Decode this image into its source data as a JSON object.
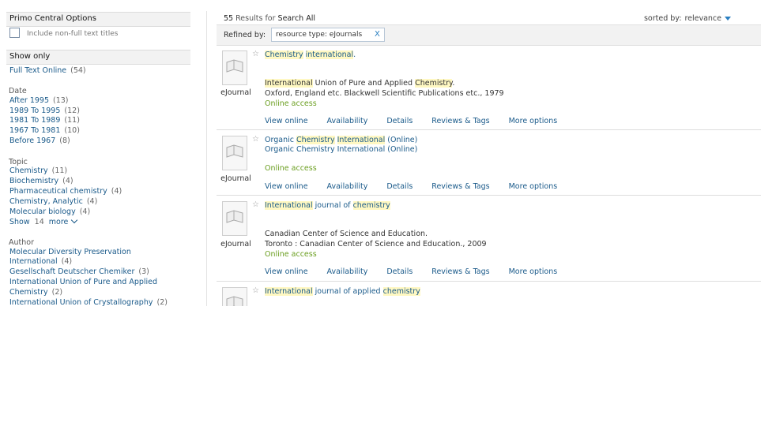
{
  "left": {
    "primo_header": "Primo Central Options",
    "include_label": "Include non-full text titles",
    "show_only_header": "Show only",
    "full_text": {
      "label": "Full Text Online",
      "count": "(54)"
    },
    "date_title": "Date",
    "dates": [
      {
        "label": "After 1995",
        "count": "(13)"
      },
      {
        "label": "1989 To 1995",
        "count": "(12)"
      },
      {
        "label": "1981 To 1989",
        "count": "(11)"
      },
      {
        "label": "1967 To 1981",
        "count": "(10)"
      },
      {
        "label": "Before 1967",
        "count": "(8)"
      }
    ],
    "topic_title": "Topic",
    "topics": [
      {
        "label": "Chemistry",
        "count": "(11)"
      },
      {
        "label": "Biochemistry",
        "count": "(4)"
      },
      {
        "label": "Pharmaceutical chemistry",
        "count": "(4)"
      },
      {
        "label": "Chemistry, Analytic",
        "count": "(4)"
      },
      {
        "label": "Molecular biology",
        "count": "(4)"
      }
    ],
    "show_more": {
      "show": "Show",
      "count": "14",
      "more": "more"
    },
    "author_title": "Author",
    "authors": [
      {
        "line1": "Molecular Diversity Preservation",
        "line2": "International",
        "count": "(4)"
      },
      {
        "line1": "Gesellschaft Deutscher Chemiker",
        "count": "(3)"
      },
      {
        "line1": "International Union of Pure and Applied",
        "line2": "Chemistry",
        "count": "(2)"
      },
      {
        "line1": "International Union of Crystallography",
        "count": "(2)"
      }
    ]
  },
  "top": {
    "count": "55",
    "results_for": "Results for",
    "scope": "Search All",
    "sorted_by": "sorted by:",
    "sort_value": "relevance",
    "refined_by": "Refined by:",
    "chip": "resource type: eJournals",
    "chip_remove": "X"
  },
  "results": [
    {
      "type": "eJournal",
      "title_parts": [
        "Chemistry",
        " ",
        "international",
        "."
      ],
      "creator_parts": [
        "International",
        " Union of Pure and Applied ",
        "Chemistry",
        "."
      ],
      "publisher": "Oxford, England etc. Blackwell Scientific Publications etc., 1979",
      "online": "Online access"
    },
    {
      "type": "eJournal",
      "title_parts": [
        "Organic ",
        "Chemistry",
        " ",
        "International",
        " (Online)"
      ],
      "subtitle": "Organic Chemistry International (Online)",
      "online": "Online access"
    },
    {
      "type": "eJournal",
      "title_parts": [
        "International",
        " journal of ",
        "chemistry"
      ],
      "creator": "Canadian Center of Science and Education.",
      "publisher": "Toronto : Canadian Center of Science and Education., 2009",
      "online": "Online access"
    },
    {
      "type": "eJournal",
      "title_parts": [
        "International",
        " journal of applied ",
        "chemistry"
      ]
    }
  ],
  "actions": {
    "view_online": "View online",
    "availability": "Availability",
    "details": "Details",
    "reviews": "Reviews & Tags",
    "more": "More options"
  },
  "icons": {
    "star": "star-icon",
    "journal": "book-icon",
    "sort": "chevron-down-icon"
  },
  "colors": {
    "link": "#1a5a8a",
    "online": "#6a9e1f",
    "highlight": "#fff8c2",
    "accent": "#2a7fc1"
  }
}
